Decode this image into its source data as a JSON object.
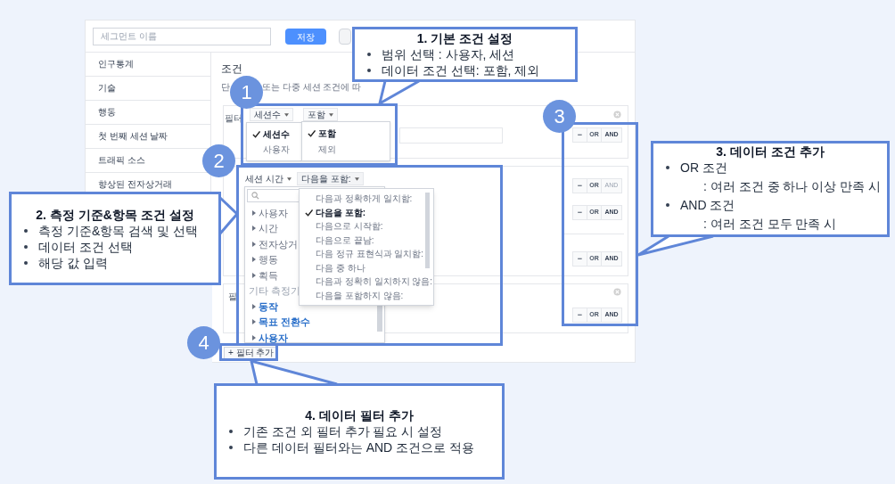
{
  "segment_name": {
    "placeholder": "세그먼트 이름"
  },
  "save_button": "저장",
  "sidebar": {
    "items": [
      "인구통계",
      "기술",
      "행동",
      "첫 번째 세션 날짜",
      "트래픽 소스",
      "향상된 전자상거래"
    ]
  },
  "conditions": {
    "title": "조건",
    "subtitle_parts": [
      "단",
      "또는 다중 세션 조건에 따"
    ]
  },
  "filter_1": {
    "label": "필터",
    "scope": "세션수",
    "mode": "포함",
    "scope_menu": [
      {
        "label": "세션수",
        "selected": true
      },
      {
        "label": "사용자",
        "selected": false
      }
    ],
    "mode_menu": [
      {
        "label": "포함",
        "selected": true
      },
      {
        "label": "제외",
        "selected": false
      }
    ]
  },
  "filter_2": {
    "dimension": "세션 시간",
    "operator": "다음을 포함:",
    "dimension_tree": [
      {
        "label": "사용자",
        "kind": "category"
      },
      {
        "label": "시간",
        "kind": "category"
      },
      {
        "label": "전자상거",
        "kind": "category"
      },
      {
        "label": "행동",
        "kind": "category"
      },
      {
        "label": "획득",
        "kind": "category"
      },
      {
        "label": "기타 측정기",
        "kind": "header"
      },
      {
        "label": "동작",
        "kind": "metric"
      },
      {
        "label": "목표 전환수",
        "kind": "metric"
      },
      {
        "label": "사용자",
        "kind": "metric"
      }
    ],
    "operator_menu": [
      {
        "label": "다음과 정확하게 일치함:",
        "selected": false
      },
      {
        "label": "다음을 포함:",
        "selected": true
      },
      {
        "label": "다음으로 시작함:",
        "selected": false
      },
      {
        "label": "다음으로 끝남:",
        "selected": false
      },
      {
        "label": "다음 정규 표현식과 일치함:",
        "selected": false
      },
      {
        "label": "다음 중 하나",
        "selected": false
      },
      {
        "label": "다음과 정확히 일치하지 않음:",
        "selected": false
      },
      {
        "label": "다음을 포함하지 않음:",
        "selected": false
      }
    ]
  },
  "filter_3": {
    "label": "필"
  },
  "logic_groups": [
    {
      "minus": "−",
      "or": "OR",
      "and": "AND",
      "and_disabled": false
    },
    {
      "minus": "−",
      "or": "OR",
      "and": "AND",
      "and_disabled": true
    },
    {
      "minus": "−",
      "or": "OR",
      "and": "AND",
      "and_disabled": false
    },
    {
      "minus": "−",
      "or": "OR",
      "and": "AND",
      "and_disabled": false
    },
    {
      "minus": "−",
      "or": "OR",
      "and": "AND",
      "and_disabled": false
    }
  ],
  "add_filter_button": "+ 필터 추가",
  "steps": [
    "1",
    "2",
    "3",
    "4"
  ],
  "callouts": [
    {
      "title": "1. 기본 조건 설정",
      "bullets": [
        {
          "text": "범위 선택 : 사용자, 세션"
        },
        {
          "text": "데이터 조건 선택: 포함, 제외"
        }
      ]
    },
    {
      "title": "2. 측정 기준&항목 조건 설정",
      "bullets": [
        {
          "text": "측정 기준&항목 검색 및 선택"
        },
        {
          "text": "데이터 조건 선택"
        },
        {
          "text": "해당 값 입력"
        }
      ]
    },
    {
      "title": "3. 데이터 조건 추가",
      "bullets": [
        {
          "text": "OR 조건",
          "detail": ": 여러 조건 중 하나 이상 만족 시"
        },
        {
          "text": "AND 조건",
          "detail": ": 여러 조건 모두 만족 시"
        }
      ]
    },
    {
      "title": "4. 데이터 필터 추가",
      "bullets": [
        {
          "text": "기존 조건 외 필터 추가 필요 시 설정"
        },
        {
          "text": "다른 데이터 필터와는 AND 조건으로 적용"
        }
      ]
    }
  ]
}
